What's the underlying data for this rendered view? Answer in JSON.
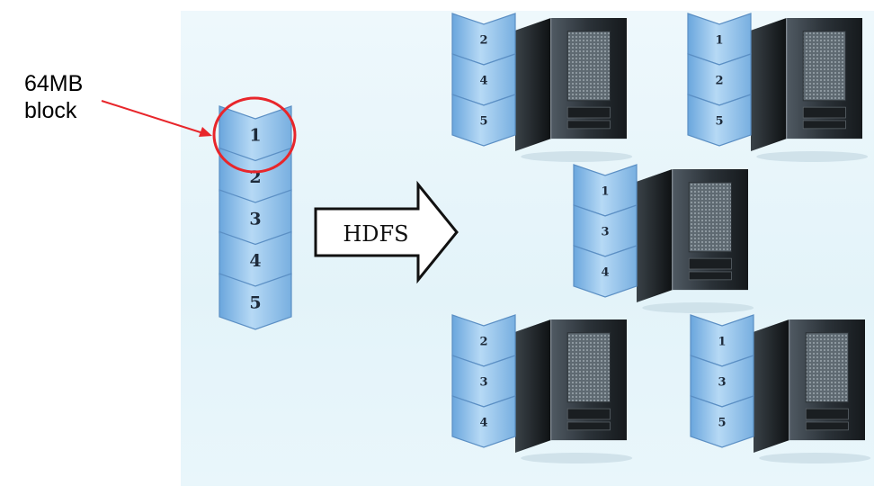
{
  "callout": {
    "label": "64MB\nblock"
  },
  "arrow_label": "HDFS",
  "source_file": {
    "blocks": [
      "1",
      "2",
      "3",
      "4",
      "5"
    ]
  },
  "nodes": [
    {
      "blocks": [
        "2",
        "4",
        "5"
      ]
    },
    {
      "blocks": [
        "1",
        "2",
        "5"
      ]
    },
    {
      "blocks": [
        "1",
        "3",
        "4"
      ]
    },
    {
      "blocks": [
        "2",
        "3",
        "4"
      ]
    },
    {
      "blocks": [
        "1",
        "3",
        "5"
      ]
    }
  ],
  "colors": {
    "block_fill": "#8fc0e8",
    "block_stroke": "#5b8fc4",
    "highlight_circle": "#e8262b",
    "pointer_arrow": "#e8262b"
  }
}
